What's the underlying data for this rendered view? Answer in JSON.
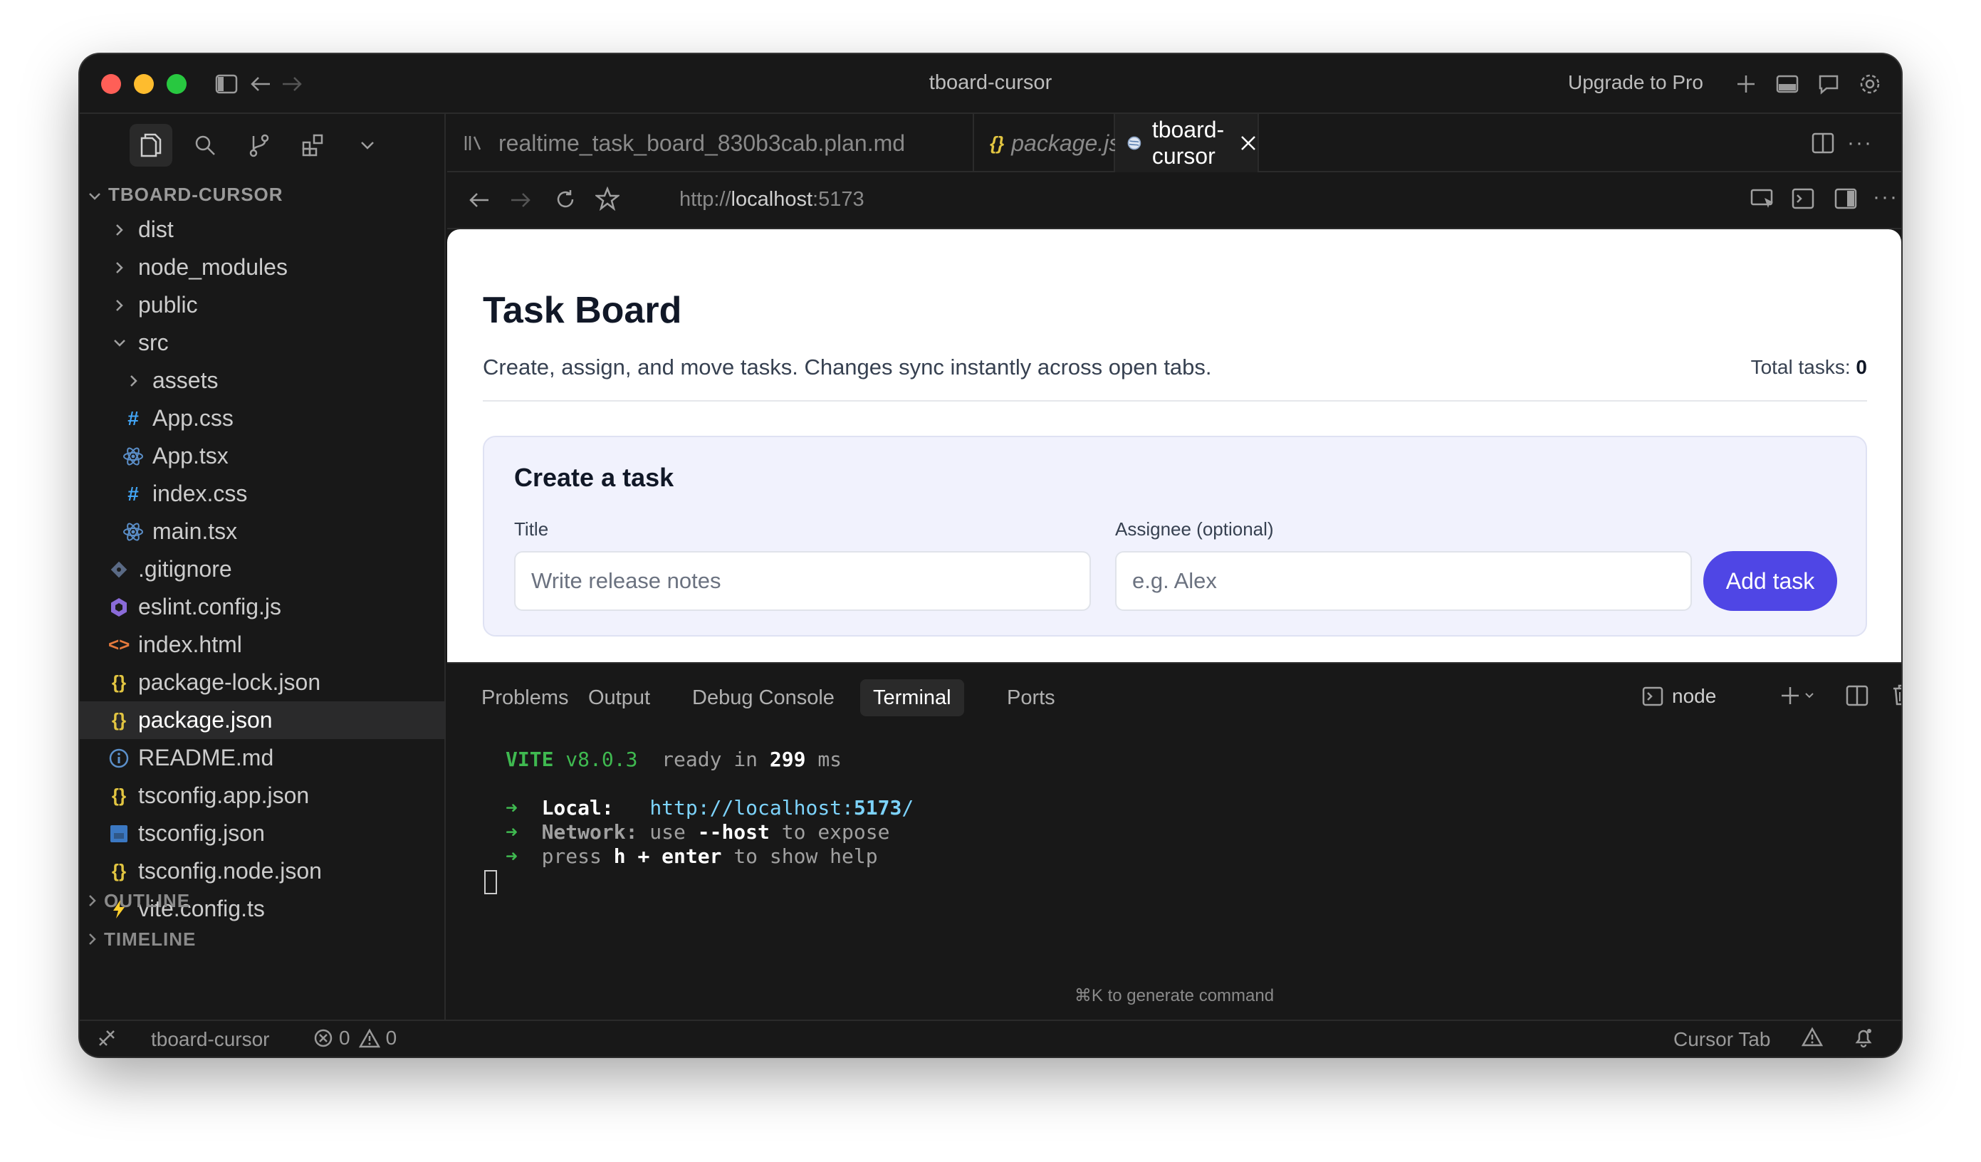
{
  "window": {
    "title": "tboard-cursor",
    "upgrade_label": "Upgrade to Pro"
  },
  "explorer": {
    "root": "TBOARD-CURSOR",
    "items": [
      {
        "label": "dist",
        "type": "folder"
      },
      {
        "label": "node_modules",
        "type": "folder"
      },
      {
        "label": "public",
        "type": "folder"
      },
      {
        "label": "src",
        "type": "folder-open"
      },
      {
        "label": "assets",
        "type": "folder"
      },
      {
        "label": "App.css",
        "type": "css"
      },
      {
        "label": "App.tsx",
        "type": "react"
      },
      {
        "label": "index.css",
        "type": "css"
      },
      {
        "label": "main.tsx",
        "type": "react"
      },
      {
        "label": ".gitignore",
        "type": "git"
      },
      {
        "label": "eslint.config.js",
        "type": "eslint"
      },
      {
        "label": "index.html",
        "type": "html"
      },
      {
        "label": "package-lock.json",
        "type": "json"
      },
      {
        "label": "package.json",
        "type": "json"
      },
      {
        "label": "README.md",
        "type": "info"
      },
      {
        "label": "tsconfig.app.json",
        "type": "json"
      },
      {
        "label": "tsconfig.json",
        "type": "ts"
      },
      {
        "label": "tsconfig.node.json",
        "type": "json"
      },
      {
        "label": "vite.config.ts",
        "type": "vite"
      }
    ],
    "outline_label": "OUTLINE",
    "timeline_label": "TIMELINE"
  },
  "tabs": [
    {
      "label": "realtime_task_board_830b3cab.plan.md"
    },
    {
      "label": "package.json"
    },
    {
      "label": "tboard-cursor"
    }
  ],
  "browser": {
    "url_prefix": "http://",
    "url_host": "localhost",
    "url_port": ":5173"
  },
  "app": {
    "title": "Task Board",
    "subtitle": "Create, assign, and move tasks. Changes sync instantly across open tabs.",
    "total_label": "Total tasks:",
    "total_value": "0",
    "card_title": "Create a task",
    "title_label": "Title",
    "title_placeholder": "Write release notes",
    "assignee_label": "Assignee (optional)",
    "assignee_placeholder": "e.g. Alex",
    "add_button": "Add task"
  },
  "panel": {
    "tabs": [
      "Problems",
      "Output",
      "Debug Console",
      "Terminal",
      "Ports"
    ],
    "active_tab": "Terminal",
    "shell_name": "node",
    "hint": "⌘K to generate command"
  },
  "terminal": {
    "vite_label": "VITE",
    "vite_version": "v8.0.3",
    "ready_text": "ready in",
    "ready_ms": "299",
    "ms_label": "ms",
    "local_label": "Local:",
    "local_url": "http://localhost:",
    "local_port": "5173",
    "local_slash": "/",
    "network_label": "Network:",
    "network_use": "use",
    "network_flag": "--host",
    "network_rest": "to expose",
    "press_text": "press",
    "press_keys": "h + enter",
    "press_rest": "to show help"
  },
  "status": {
    "project": "tboard-cursor",
    "errors": "0",
    "warnings": "0",
    "cursor_tab": "Cursor Tab"
  },
  "colors": {
    "accent": "#4f46e5",
    "vite_green": "#3fb950",
    "link_cyan": "#7dd3fc"
  }
}
